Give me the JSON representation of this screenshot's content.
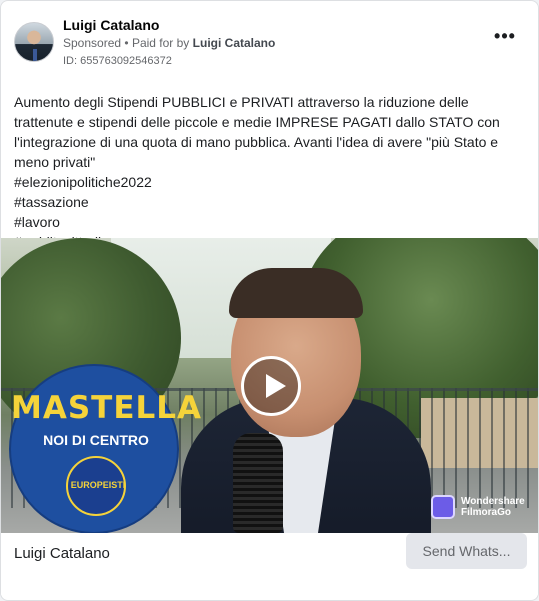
{
  "post": {
    "author": "Luigi Catalano",
    "sponsored_label": "Sponsored",
    "paid_for_prefix": "Paid for by",
    "paid_for_name": "Luigi Catalano",
    "ad_id": "ID: 655763092546372",
    "more_icon": "•••",
    "body_lines": [
      "Aumento degli Stipendi PUBBLICI e PRIVATI attraverso la riduzione delle trattenute e stipendi delle piccole e medie IMPRESE PAGATI dallo STATO con l'integrazione di una quota di mano pubblica. Avanti l'idea di avere \"più Stato e meno privati\"",
      "#elezionipolitiche2022",
      "#tassazione",
      "#lavoro",
      "#redditocittadinanza..."
    ]
  },
  "media": {
    "logo_title": "MASTELLA",
    "logo_subtitle": "NOI DI CENTRO",
    "logo_badge": "EUROPEISTI",
    "watermark_line1": "Wondershare",
    "watermark_line2": "FilmoraGo",
    "play_icon": "play-icon"
  },
  "footer": {
    "title": "Luigi Catalano",
    "cta_label": "Send Whats..."
  }
}
